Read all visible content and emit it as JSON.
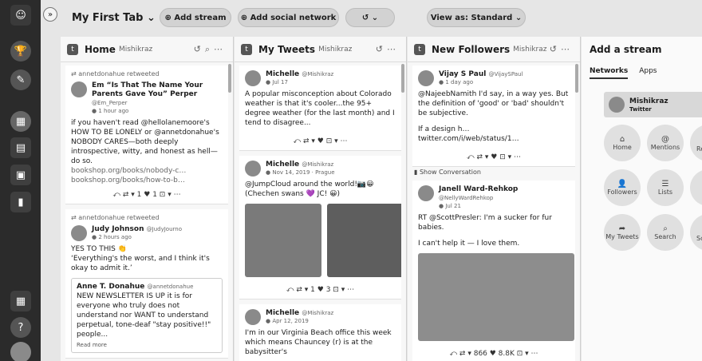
{
  "topbar": {
    "tab_title": "My First Tab ⌄",
    "add_stream": "Add stream",
    "add_social": "Add social network",
    "refresh": "↺  ⌄",
    "view_as": "View as: Standard ⌄"
  },
  "columns": {
    "home": {
      "title": "Home",
      "sub": "Mishikraz",
      "posts": [
        {
          "rt": "annetdonahue retweeted",
          "name": "Em “Is That The Name Your Parents Gave You” Perper",
          "handle": "@Em_Perper",
          "time": "1 hour ago",
          "text": "if you haven't read @hellolanemoore's HOW TO BE LONELY or @annetdonahue's NOBODY CARES—both deeply introspective, witty, and honest as hell—do so.",
          "link1": "bookshop.org/books/nobody-c…",
          "link2": "bookshop.org/books/how-to-b…",
          "actions": "⤺   ⇄ ▾ 1  ♥ 1  ⊡ ▾  ⋯"
        },
        {
          "rt": "annetdonahue retweeted",
          "name": "Judy Johnson",
          "handle": "@JudyJourno",
          "time": "2 hours ago",
          "text": "YES TO THIS 👏\n‘Everything's the worst, and I think it's okay to admit it.’",
          "quote_name": "Anne T. Donahue",
          "quote_handle": "@annetdonahue",
          "quote_text": "NEW NEWSLETTER IS UP it is for everyone who truly does not understand nor WANT to understand perpetual, tone-deaf \"stay positive!!\" people...",
          "read_more": "Read more"
        }
      ]
    },
    "tweets": {
      "title": "My Tweets",
      "sub": "Mishikraz",
      "posts": [
        {
          "name": "Michelle",
          "handle": "@Mishikraz",
          "time": "Jul 17",
          "text": "A popular misconception about Colorado weather is that it's cooler...the 95+ degree weather (for the last month) and I tend to disagree...",
          "actions": "⤺   ⇄ ▾  ♥  ⊡ ▾  ⋯"
        },
        {
          "name": "Michelle",
          "handle": "@Mishikraz",
          "time": "Nov 14, 2019 · Prague",
          "text": "@JumpCloud around the world!📷😀 (Chechen swans 💜 JC! 😀)",
          "actions": "⤺   ⇄ ▾ 1  ♥ 3  ⊡ ▾  ⋯"
        },
        {
          "name": "Michelle",
          "handle": "@Mishikraz",
          "time": "Apr 12, 2019",
          "text": "I'm in our Virginia Beach office this week which means Chauncey (r) is at the babysitter's"
        }
      ]
    },
    "followers": {
      "title": "New Followers",
      "sub": "Mishikraz",
      "posts": [
        {
          "name": "Vijay S Paul",
          "handle": "@VijaySPaul",
          "time": "1 day ago",
          "text": "@NajeebNamith I'd say, in a way yes. But the definition of 'good' or 'bad' shouldn't be subjective.",
          "text2": "If a design h… twitter.com/i/web/status/1…",
          "actions": "⤺   ⇄ ▾  ♥  ⊡ ▾  ⋯",
          "conversation": "Show Conversation"
        },
        {
          "name": "Janell Ward-Rehkop",
          "handle": "@NellyWardRehkop",
          "time": "Jul 21",
          "text": "RT @ScottPresler: I'm a sucker for fur babies.",
          "text2": "I can't help it — I love them.",
          "actions": "⤺   ⇄ ▾ 866  ♥ 8.8K  ⊡ ▾  ⋯"
        }
      ]
    }
  },
  "add_stream": {
    "title": "Add a stream",
    "tabs": [
      "Networks",
      "Apps"
    ],
    "account_name": "Mishikraz",
    "account_net": "Twitter",
    "options": [
      {
        "icon": "⌂",
        "label": "Home"
      },
      {
        "icon": "@",
        "label": "Mentions"
      },
      {
        "icon": "",
        "label": "Re"
      },
      {
        "icon": "👤",
        "label": "Followers"
      },
      {
        "icon": "☰",
        "label": "Lists"
      },
      {
        "icon": "",
        "label": ""
      },
      {
        "icon": "➦",
        "label": "My Tweets"
      },
      {
        "icon": "⌕",
        "label": "Search"
      },
      {
        "icon": "",
        "label": "Sc"
      }
    ]
  }
}
